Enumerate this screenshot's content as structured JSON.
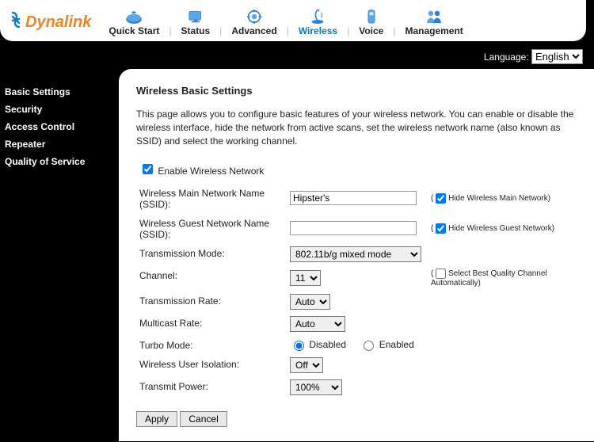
{
  "brand": "Dynalink",
  "nav": [
    "Quick Start",
    "Status",
    "Advanced",
    "Wireless",
    "Voice",
    "Management"
  ],
  "nav_active": "Wireless",
  "language_label": "Language:",
  "language_value": "English",
  "language_options": [
    "English"
  ],
  "sidebar": [
    "Basic Settings",
    "Security",
    "Access Control",
    "Repeater",
    "Quality of Service"
  ],
  "page": {
    "title": "Wireless Basic Settings",
    "description": "This page allows you to configure basic features of your wireless network. You can enable or disable the wireless interface, hide the network from active scans, set the wireless network name (also known as SSID) and select the working channel.",
    "enable_label": "Enable Wireless Network",
    "enable_checked": true,
    "main_ssid_label": "Wireless Main Network Name (SSID):",
    "main_ssid_value": "Hipster's",
    "hide_main_label": "Hide Wireless Main Network",
    "hide_main_checked": true,
    "guest_ssid_label": "Wireless Guest Network Name (SSID):",
    "guest_ssid_value": "",
    "hide_guest_label": "Hide Wireless Guest Network",
    "hide_guest_checked": true,
    "tx_mode_label": "Transmission Mode:",
    "tx_mode_value": "802.11b/g mixed mode",
    "tx_mode_options": [
      "802.11b/g mixed mode"
    ],
    "channel_label": "Channel:",
    "channel_value": "11",
    "channel_options": [
      "11"
    ],
    "channel_auto_label": "Select Best Quality Channel Automatically",
    "channel_auto_checked": false,
    "tx_rate_label": "Transmission Rate:",
    "tx_rate_value": "Auto",
    "tx_rate_options": [
      "Auto"
    ],
    "multicast_label": "Multicast Rate:",
    "multicast_value": "Auto",
    "multicast_options": [
      "Auto"
    ],
    "turbo_label": "Turbo Mode:",
    "turbo_value": "Disabled",
    "turbo_disabled_label": "Disabled",
    "turbo_enabled_label": "Enabled",
    "isolation_label": "Wireless User Isolation:",
    "isolation_value": "Off",
    "isolation_options": [
      "Off"
    ],
    "power_label": "Transmit Power:",
    "power_value": "100%",
    "power_options": [
      "100%"
    ],
    "apply": "Apply",
    "cancel": "Cancel"
  }
}
